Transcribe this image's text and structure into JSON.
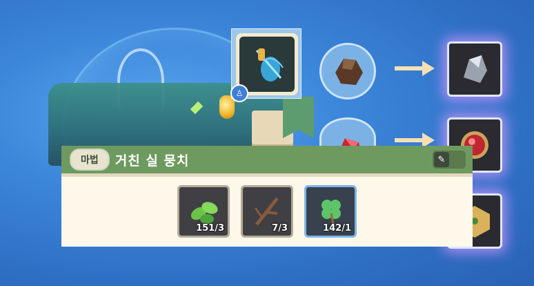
{
  "recipe": {
    "main_item_icon": "thread-spool-icon",
    "category_label": "마법",
    "item_name": "거친 실 뭉치",
    "materials": [
      {
        "icon": "leaves-icon",
        "count": "151/3"
      },
      {
        "icon": "twig-icon",
        "count": "7/3"
      },
      {
        "icon": "clover-icon",
        "count": "142/1"
      }
    ]
  },
  "results": [
    {
      "icon": "silver-ore-icon"
    },
    {
      "icon": "ruby-gem-icon"
    },
    {
      "icon": "gold-dice-icon"
    }
  ],
  "inputs": [
    {
      "icon": "rough-ore-icon"
    },
    {
      "icon": "red-gem-icon"
    }
  ],
  "colors": {
    "header": "#6e9a5f",
    "body": "#fdf8ea",
    "glow": "#d296ff"
  }
}
